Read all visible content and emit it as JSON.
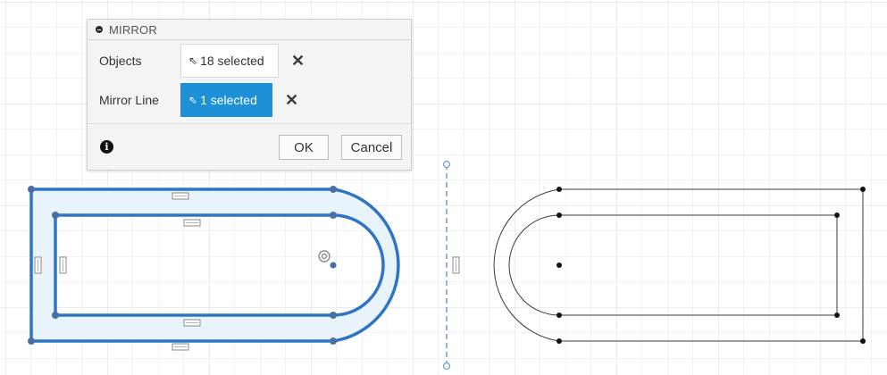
{
  "dialog": {
    "title": "MIRROR",
    "objects_label": "Objects",
    "objects_value": "18 selected",
    "mirror_line_label": "Mirror Line",
    "mirror_line_value": "1 selected",
    "ok_label": "OK",
    "cancel_label": "Cancel",
    "clear_glyph": "✕",
    "cursor_glyph": "⇖",
    "info_glyph": "i"
  },
  "colors": {
    "selection_blue": "#2e75c6",
    "selection_fill": "#e8f2fb",
    "mirror_line_blue": "#6d9fd6",
    "sketch_line": "#3a3a3a",
    "active_field": "#1e90d8"
  }
}
